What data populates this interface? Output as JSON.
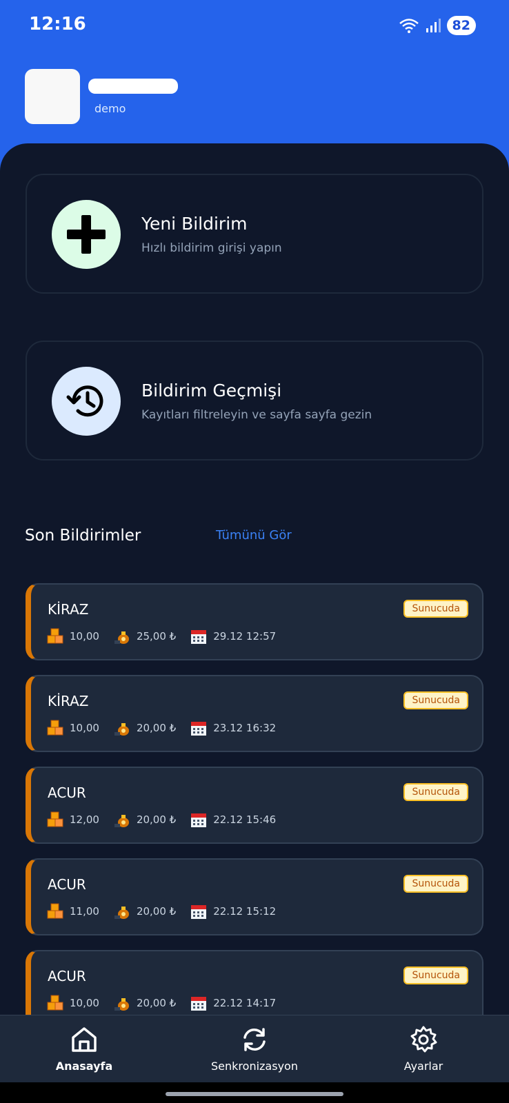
{
  "status_bar": {
    "time": "12:16",
    "battery": "82"
  },
  "header": {
    "subtitle": "demo"
  },
  "actions": [
    {
      "title": "Yeni Bildirim",
      "subtitle": "Hızlı bildirim girişi yapın"
    },
    {
      "title": "Bildirim Geçmişi",
      "subtitle": "Kayıtları filtreleyin ve sayfa sayfa gezin"
    }
  ],
  "recent": {
    "title": "Son Bildirimler",
    "see_all": "Tümünü Gör",
    "items": [
      {
        "name": "KİRAZ",
        "status": "Sunucuda",
        "quantity": "10,00",
        "price": "25,00 ₺",
        "date": "29.12 12:57"
      },
      {
        "name": "KİRAZ",
        "status": "Sunucuda",
        "quantity": "10,00",
        "price": "20,00 ₺",
        "date": "23.12 16:32"
      },
      {
        "name": "ACUR",
        "status": "Sunucuda",
        "quantity": "12,00",
        "price": "20,00 ₺",
        "date": "22.12 15:46"
      },
      {
        "name": "ACUR",
        "status": "Sunucuda",
        "quantity": "11,00",
        "price": "20,00 ₺",
        "date": "22.12 15:12"
      },
      {
        "name": "ACUR",
        "status": "Sunucuda",
        "quantity": "10,00",
        "price": "20,00 ₺",
        "date": "22.12 14:17"
      }
    ]
  },
  "nav": [
    {
      "label": "Anasayfa",
      "icon": "home-icon",
      "active": true
    },
    {
      "label": "Senkronizasyon",
      "icon": "sync-icon",
      "active": false
    },
    {
      "label": "Ayarlar",
      "icon": "gear-icon",
      "active": false
    }
  ],
  "colors": {
    "primary": "#2563eb",
    "background": "#0f172a",
    "card": "#1e293b",
    "accent_bar": "#d97706",
    "badge_bg": "#fef3c7",
    "link": "#3b82f6"
  }
}
